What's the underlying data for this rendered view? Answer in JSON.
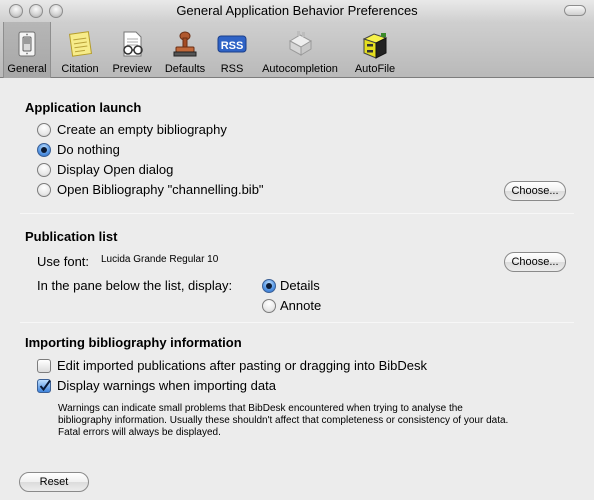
{
  "window": {
    "title": "General Application Behavior Preferences"
  },
  "toolbar": {
    "items": [
      {
        "label": "General",
        "icon": "light-switch-icon",
        "selected": true
      },
      {
        "label": "Citation",
        "icon": "notepad-icon"
      },
      {
        "label": "Preview",
        "icon": "document-glasses-icon"
      },
      {
        "label": "Defaults",
        "icon": "rubber-stamp-icon"
      },
      {
        "label": "RSS",
        "icon": "rss-icon"
      },
      {
        "label": "Autocompletion",
        "icon": "type-case-icon"
      },
      {
        "label": "AutoFile",
        "icon": "file-cabinet-icon"
      }
    ]
  },
  "launch": {
    "heading": "Application launch",
    "options": [
      {
        "label": "Create an empty bibliography",
        "selected": false
      },
      {
        "label": "Do nothing",
        "selected": true
      },
      {
        "label": "Display Open dialog",
        "selected": false
      },
      {
        "label": "Open Bibliography \"channelling.bib\"",
        "selected": false
      }
    ],
    "choose_label": "Choose..."
  },
  "pub": {
    "heading": "Publication list",
    "font_label": "Use font:",
    "font_value": "Lucida Grande Regular 10",
    "font_choose_label": "Choose...",
    "pane_label": "In the pane below the list, display:",
    "pane_options": [
      {
        "label": "Details",
        "selected": true
      },
      {
        "label": "Annote",
        "selected": false
      }
    ]
  },
  "importing": {
    "heading": "Importing bibliography information",
    "edit_label": "Edit imported publications after pasting or dragging into BibDesk",
    "edit_checked": false,
    "warn_label": "Display warnings when importing data",
    "warn_checked": true,
    "note_lines": [
      "Warnings can indicate small problems that BibDesk encountered when trying to analyse the",
      "bibliography information. Usually these shouldn't affect that completeness or consistency of your data.",
      "Fatal errors will always be displayed."
    ]
  },
  "reset_label": "Reset",
  "colors": {
    "accent": "#3e83db",
    "window_bg": "#ececec",
    "toolbar_bg": "#c4c4c4"
  }
}
